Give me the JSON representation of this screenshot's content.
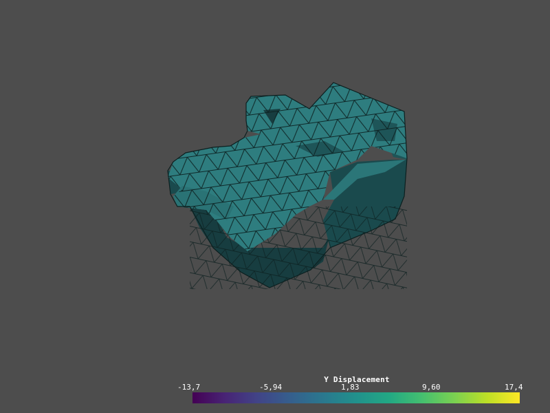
{
  "scalar_bar": {
    "title": "Y Displacement",
    "tick_labels": [
      "-13,7",
      "-5,94",
      "1,83",
      "9,60",
      "17,4"
    ],
    "range": [
      -13.7,
      17.4
    ],
    "colormap": "viridis"
  },
  "colors": {
    "background": "#4d4d4d",
    "mesh_surface": "#2e8080",
    "mesh_edges": "#000000"
  }
}
